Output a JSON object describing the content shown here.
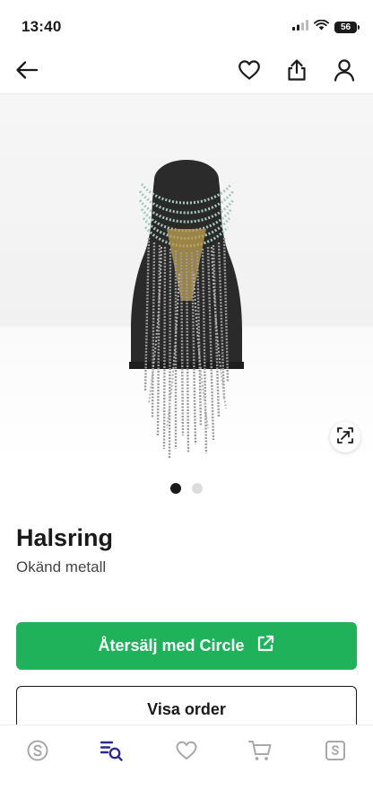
{
  "status_bar": {
    "time": "13:40",
    "battery": "56"
  },
  "product": {
    "title": "Halsring",
    "subtitle": "Okänd metall"
  },
  "actions": {
    "resell_label": "Återsälj med Circle",
    "order_label": "Visa order"
  },
  "gallery": {
    "image_count": 2,
    "active_index": 0
  },
  "nav_icons": [
    "back-arrow-icon",
    "heart-icon",
    "share-icon",
    "profile-icon"
  ],
  "tab_icons": [
    "sellpy-logo-icon",
    "orders-search-icon",
    "favorites-heart-icon",
    "cart-icon",
    "sales-icon"
  ],
  "colors": {
    "accent_green": "#1fb25a",
    "active_tab": "#2a2ab8",
    "inactive_icon": "#a8a8a8"
  }
}
